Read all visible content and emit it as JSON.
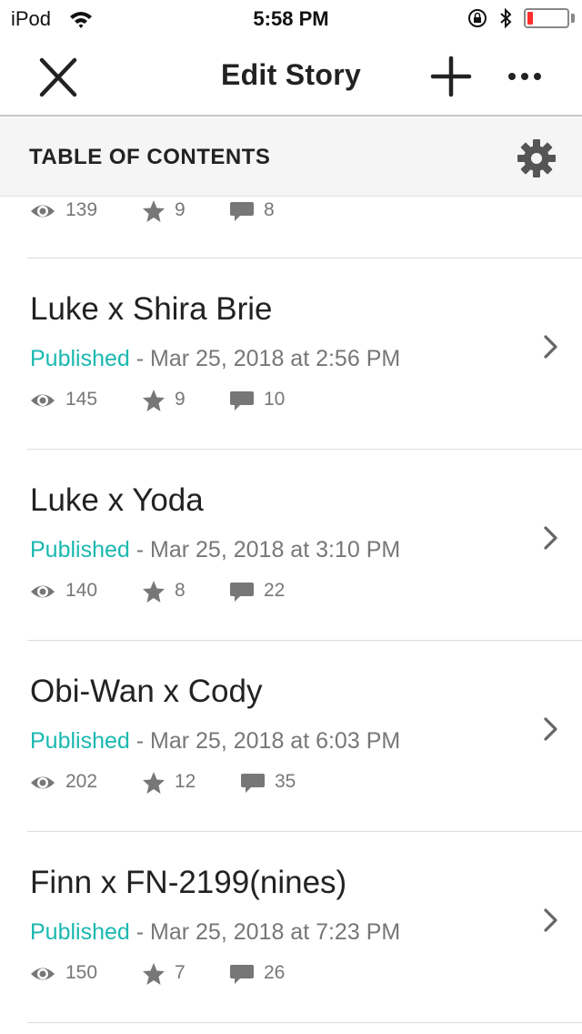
{
  "status_bar": {
    "carrier": "iPod",
    "time": "5:58 PM"
  },
  "nav": {
    "title": "Edit Story"
  },
  "toc": {
    "title": "TABLE OF CONTENTS"
  },
  "partial_part": {
    "views": "139",
    "votes": "9",
    "comments": "8"
  },
  "parts": [
    {
      "title": "Luke x Shira Brie",
      "status": "Published",
      "date": "Mar 25, 2018 at 2:56 PM",
      "views": "145",
      "votes": "9",
      "comments": "10"
    },
    {
      "title": "Luke x Yoda",
      "status": "Published",
      "date": "Mar 25, 2018 at 3:10 PM",
      "views": "140",
      "votes": "8",
      "comments": "22"
    },
    {
      "title": "Obi-Wan x Cody",
      "status": "Published",
      "date": "Mar 25, 2018 at 6:03 PM",
      "views": "202",
      "votes": "12",
      "comments": "35"
    },
    {
      "title": "Finn x FN-2199(nines)",
      "status": "Published",
      "date": "Mar 25, 2018 at 7:23 PM",
      "views": "150",
      "votes": "7",
      "comments": "26"
    }
  ],
  "separator": " - ",
  "colors": {
    "published": "#1ab8b0",
    "meta_text": "#777777",
    "battery_low": "#ff2d2d"
  },
  "icons": {
    "close": "close-icon",
    "add": "plus-icon",
    "more": "more-icon",
    "settings": "gear-icon",
    "views": "eye-icon",
    "votes": "star-icon",
    "comments": "comment-icon",
    "row_action": "chevron-right-icon"
  }
}
